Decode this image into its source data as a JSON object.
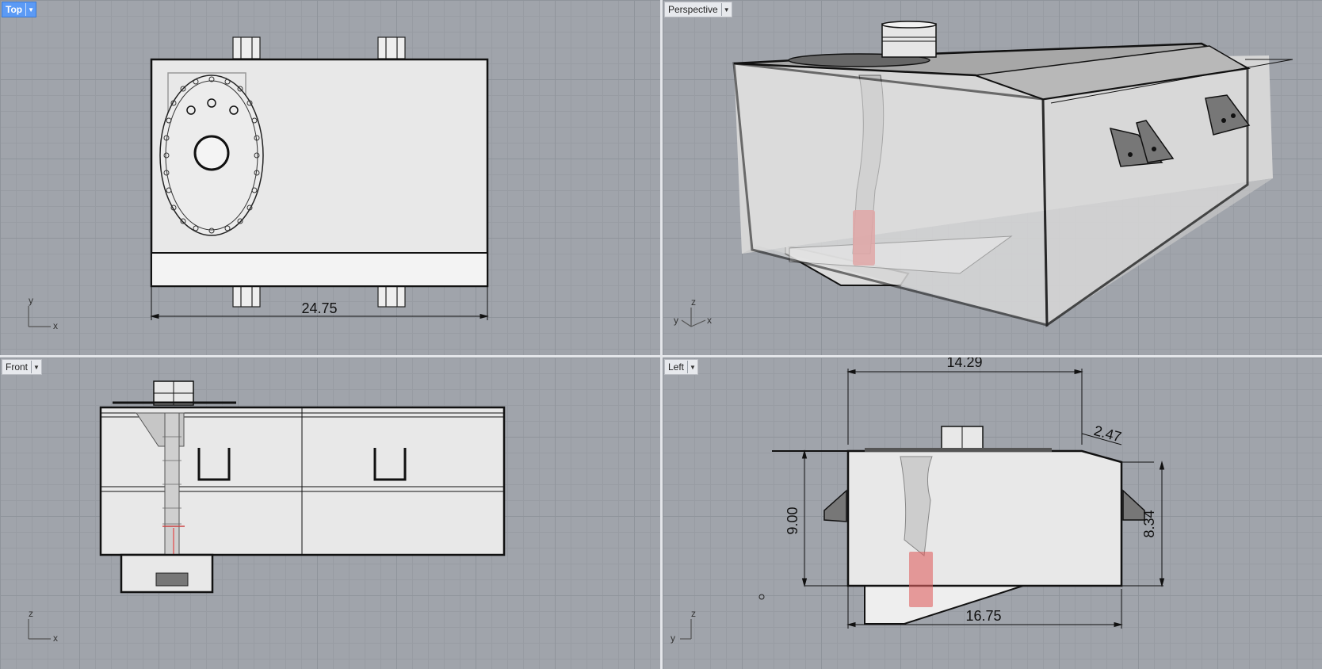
{
  "viewports": {
    "top": {
      "label": "Top"
    },
    "perspective": {
      "label": "Perspective"
    },
    "front": {
      "label": "Front"
    },
    "left": {
      "label": "Left"
    }
  },
  "dimensions": {
    "top_width": "24.75",
    "left_top": "14.29",
    "left_bevel": "2.47",
    "left_height_front": "9.00",
    "left_height_rear": "8.34",
    "left_bottom": "16.75"
  },
  "axes": {
    "top": {
      "v": "y",
      "h": "x"
    },
    "perspective": {
      "v": "z",
      "h1": "y",
      "h2": "x"
    },
    "front": {
      "v": "z",
      "h": "x"
    },
    "left": {
      "v": "z",
      "h": "y"
    }
  },
  "colors": {
    "active_label": "#5b9af5",
    "viewport_bg": "#a0a4ab",
    "pump_red": "#e06060"
  }
}
